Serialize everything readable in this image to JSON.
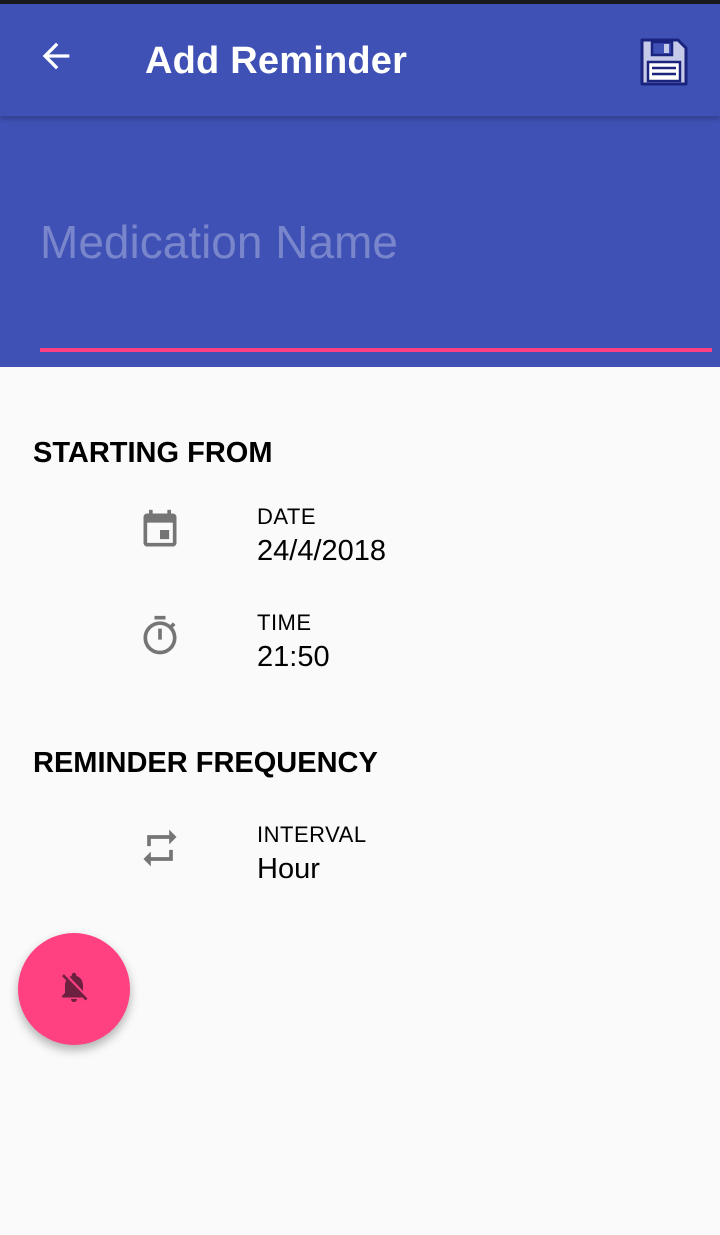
{
  "app_bar": {
    "title": "Add Reminder",
    "back_icon": "arrow-back-icon",
    "save_icon": "floppy-disk-save-icon"
  },
  "medication": {
    "placeholder": "Medication Name",
    "value": ""
  },
  "starting_from": {
    "title": "STARTING FROM",
    "date": {
      "icon": "calendar-icon",
      "label": "DATE",
      "value": "24/4/2018"
    },
    "time": {
      "icon": "stopwatch-icon",
      "label": "TIME",
      "value": "21:50"
    }
  },
  "reminder_frequency": {
    "title": "REMINDER FREQUENCY",
    "interval": {
      "icon": "repeat-icon",
      "label": "INTERVAL",
      "value": "Hour"
    }
  },
  "fab": {
    "icon": "notifications-off-icon"
  },
  "colors": {
    "primary": "#3f51b5",
    "accent": "#ff4081",
    "placeholder": "#7986cb",
    "icon_gray": "#757575",
    "background": "#fafafa"
  }
}
